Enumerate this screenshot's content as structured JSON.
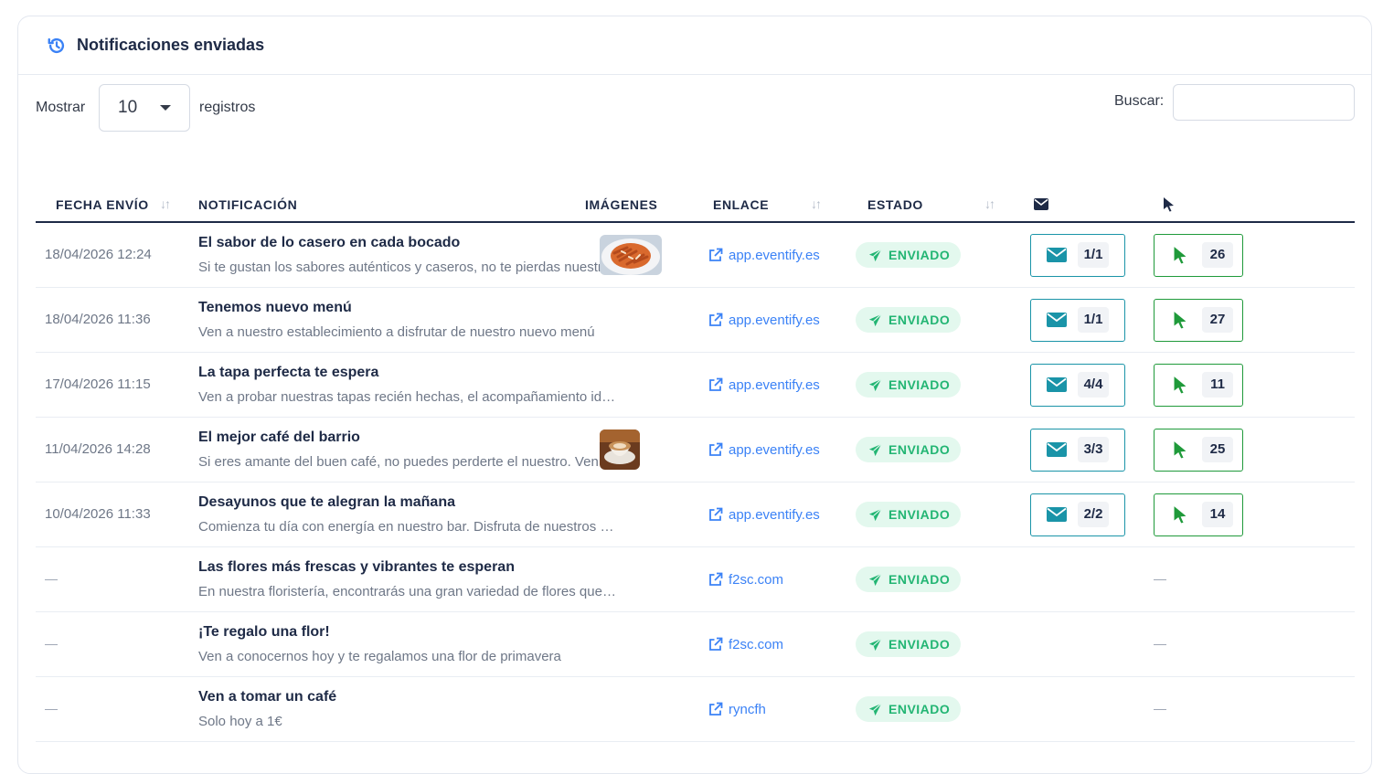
{
  "card": {
    "title": "Notificaciones enviadas",
    "icon": "history-icon"
  },
  "controls": {
    "show_label": "Mostrar",
    "page_size": "10",
    "records_label": "registros",
    "search_label": "Buscar:",
    "search_value": ""
  },
  "columns": {
    "date": "FECHA ENVÍO",
    "notification": "NOTIFICACIÓN",
    "images": "IMÁGENES",
    "link": "ENLACE",
    "status": "ESTADO",
    "sends_icon": "envelope-icon",
    "clicks_icon": "cursor-icon"
  },
  "colors": {
    "mail_accent": "#1a94a8",
    "click_accent": "#1f9a3a",
    "status_green": "#22b573",
    "link_blue": "#3b82f6"
  },
  "rows": [
    {
      "date": "18/04/2026 12:24",
      "title": "El sabor de lo casero en cada bocado",
      "body": "Si te gustan los sabores auténticos y caseros, no te pierdas nuestr…",
      "image": "pasta-thumbnail",
      "link": "app.eventify.es",
      "status": "ENVIADO",
      "sends": "1/1",
      "clicks": "26"
    },
    {
      "date": "18/04/2026 11:36",
      "title": "Tenemos nuevo menú",
      "body": "Ven a nuestro establecimiento a disfrutar de nuestro nuevo menú",
      "image": "",
      "link": "app.eventify.es",
      "status": "ENVIADO",
      "sends": "1/1",
      "clicks": "27"
    },
    {
      "date": "17/04/2026 11:15",
      "title": "La tapa perfecta te espera",
      "body": "Ven a probar nuestras tapas recién hechas, el acompañamiento id…",
      "image": "",
      "link": "app.eventify.es",
      "status": "ENVIADO",
      "sends": "4/4",
      "clicks": "11"
    },
    {
      "date": "11/04/2026 14:28",
      "title": "El mejor café del barrio",
      "body": "Si eres amante del buen café, no puedes perderte el nuestro. Ven y …",
      "image": "coffee-thumbnail",
      "link": "app.eventify.es",
      "status": "ENVIADO",
      "sends": "3/3",
      "clicks": "25"
    },
    {
      "date": "10/04/2026 11:33",
      "title": "Desayunos que te alegran la mañana",
      "body": "Comienza tu día con energía en nuestro bar. Disfruta de nuestros d…",
      "image": "",
      "link": "app.eventify.es",
      "status": "ENVIADO",
      "sends": "2/2",
      "clicks": "14"
    },
    {
      "date": "—",
      "title": "Las flores más frescas y vibrantes te esperan",
      "body": "En nuestra floristería, encontrarás una gran variedad de flores que l…",
      "image": "",
      "link": "f2sc.com",
      "status": "ENVIADO",
      "sends": "",
      "clicks": "—"
    },
    {
      "date": "—",
      "title": "¡Te regalo una flor!",
      "body": "Ven a conocernos hoy y te regalamos una flor de primavera",
      "image": "",
      "link": "f2sc.com",
      "status": "ENVIADO",
      "sends": "",
      "clicks": "—"
    },
    {
      "date": "—",
      "title": "Ven a tomar un café",
      "body": "Solo hoy a 1€",
      "image": "",
      "link": "ryncfh",
      "status": "ENVIADO",
      "sends": "",
      "clicks": "—"
    }
  ]
}
